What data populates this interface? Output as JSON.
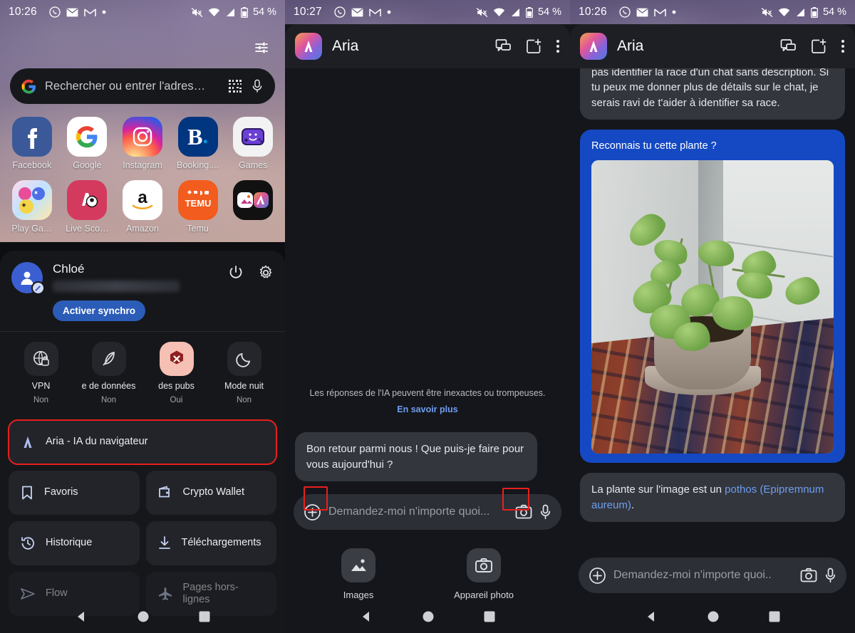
{
  "panel1": {
    "status": {
      "time": "10:26",
      "battery": "54 %"
    },
    "search": {
      "placeholder": "Rechercher ou entrer l'adres…"
    },
    "apps_row1": [
      {
        "label": "Facebook",
        "icon": "facebook-icon"
      },
      {
        "label": "Google",
        "icon": "google-icon"
      },
      {
        "label": "Instagram",
        "icon": "instagram-icon"
      },
      {
        "label": "Booking....",
        "icon": "booking-icon"
      },
      {
        "label": "Games",
        "icon": "games-icon"
      }
    ],
    "apps_row2": [
      {
        "label": "Play Ga…",
        "icon": "play-games-icon"
      },
      {
        "label": "Live Sco…",
        "icon": "livescore-icon"
      },
      {
        "label": "Amazon",
        "icon": "amazon-icon"
      },
      {
        "label": "Temu",
        "icon": "temu-icon"
      },
      {
        "label": "",
        "icon": "folder-icon"
      }
    ],
    "profile": {
      "name": "Chloé",
      "sync_button": "Activer synchro"
    },
    "toggles": [
      {
        "label": "VPN",
        "value": "Non",
        "icon": "vpn-icon",
        "active": false
      },
      {
        "label": "e de données",
        "value": "Non",
        "icon": "leaf-icon",
        "active": false
      },
      {
        "label": "des pubs",
        "value": "Oui",
        "icon": "adblock-icon",
        "active": true
      },
      {
        "label": "Mode nuit",
        "value": "Non",
        "icon": "moon-icon",
        "active": false
      }
    ],
    "menu": [
      {
        "label": "Aria - IA du navigateur",
        "icon": "aria-icon",
        "highlighted": true
      },
      {
        "label": "Favoris",
        "icon": "bookmark-icon"
      },
      {
        "label": "Crypto Wallet",
        "icon": "wallet-icon"
      },
      {
        "label": "Historique",
        "icon": "history-icon"
      },
      {
        "label": "Téléchargements",
        "icon": "download-icon"
      },
      {
        "label": "Flow",
        "icon": "flow-icon"
      },
      {
        "label": "Pages hors-lignes",
        "icon": "airplane-icon"
      }
    ]
  },
  "panel2": {
    "status": {
      "time": "10:27",
      "battery": "54 %"
    },
    "header": {
      "title": "Aria"
    },
    "disclaimer": {
      "text": "Les réponses de l'IA peuvent être inexactes ou trompeuses.",
      "link": "En savoir plus"
    },
    "messages": [
      {
        "role": "ai",
        "text": "Bon retour parmi nous ! Que puis-je faire pour vous aujourd'hui ?"
      }
    ],
    "composer": {
      "placeholder": "Demandez-moi n'importe quoi..."
    },
    "attachments": [
      {
        "label": "Images",
        "icon": "image-icon"
      },
      {
        "label": "Appareil photo",
        "icon": "camera-icon"
      }
    ]
  },
  "panel3": {
    "status": {
      "time": "10:26",
      "battery": "54 %"
    },
    "header": {
      "title": "Aria"
    },
    "messages": [
      {
        "role": "ai",
        "text": "pas identifier la race d'un chat sans description. Si tu peux me donner plus de détails sur le chat, je serais ravi de t'aider à identifier sa race."
      },
      {
        "role": "user",
        "text": "Reconnais tu cette plante ?",
        "has_image": true
      },
      {
        "role": "ai",
        "text": "La plante sur l'image est un pothos (Epipremnum aureum).",
        "link_part": "pothos (Epipremnum aureum)"
      }
    ],
    "composer": {
      "placeholder": "Demandez-moi n'importe quoi.."
    }
  },
  "colors": {
    "highlight": "#e8201d",
    "user_bubble": "#1549c4",
    "ai_bubble": "#33363d",
    "accent_link": "#6f9ef0",
    "sync_button": "#2b5cb8"
  }
}
